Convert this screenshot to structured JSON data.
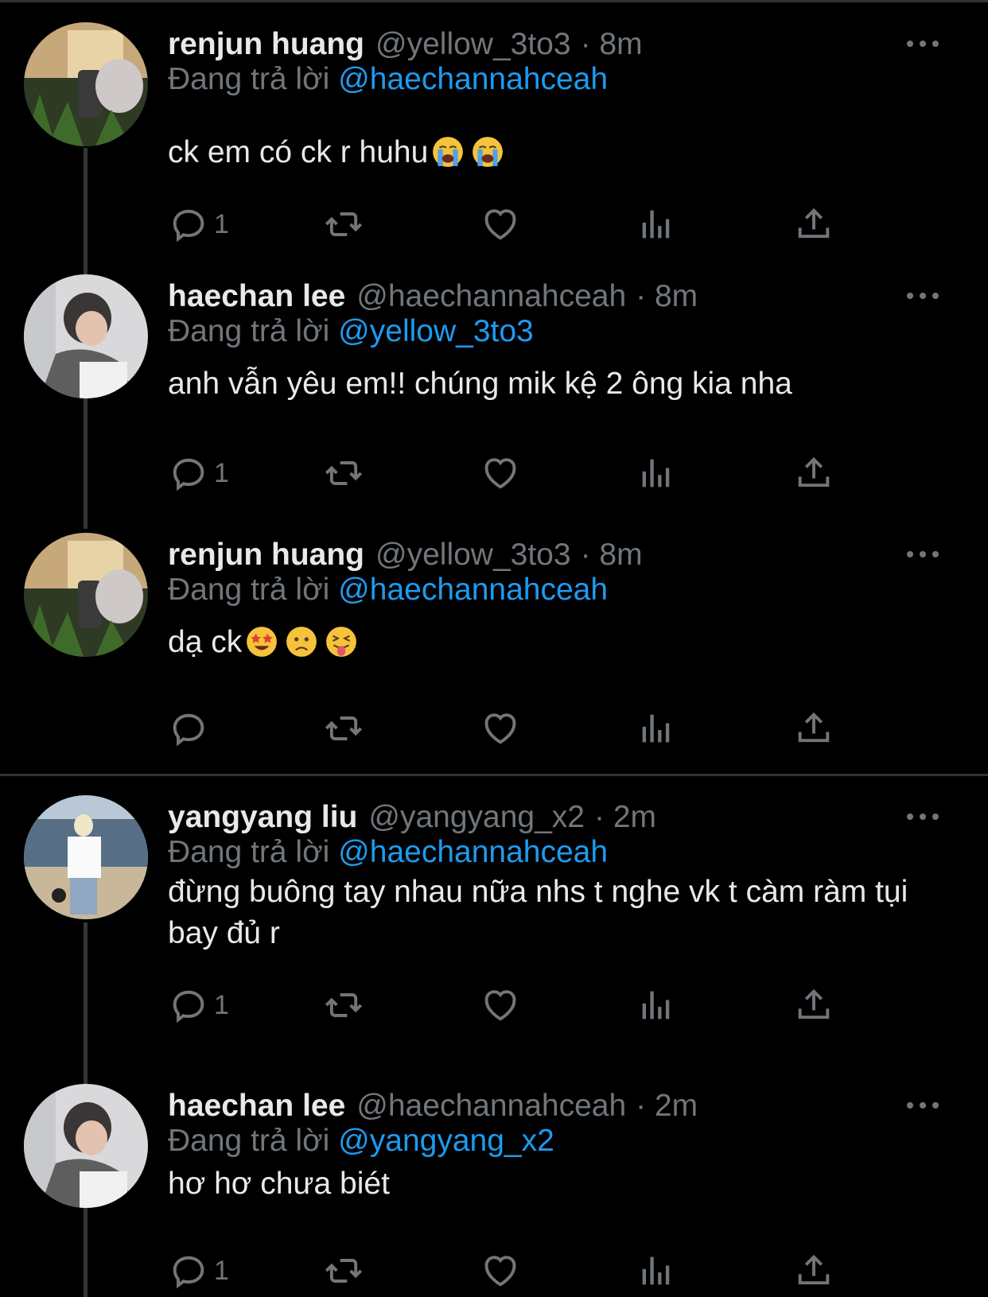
{
  "reply_prefix": "Đang trả lời",
  "tweets": [
    {
      "name": "renjun huang",
      "handle": "@yellow_3to3",
      "time": "· 8m",
      "reply_to": "@haechannahceah",
      "text": "ck em có ck r huhu",
      "emojis": [
        "loudly-crying-face-emoji",
        "loudly-crying-face-emoji"
      ],
      "replies": "1"
    },
    {
      "name": "haechan lee",
      "handle": "@haechannahceah",
      "time": "· 8m",
      "reply_to": "@yellow_3to3",
      "text": "anh vẫn yêu em!! chúng mik kệ 2 ông kia nha",
      "emojis": [],
      "replies": "1"
    },
    {
      "name": "renjun huang",
      "handle": "@yellow_3to3",
      "time": "· 8m",
      "reply_to": "@haechannahceah",
      "text": "dạ ck",
      "emojis": [
        "star-struck-emoji",
        "worried-face-emoji",
        "squinting-tongue-emoji"
      ],
      "replies": ""
    },
    {
      "name": "yangyang liu",
      "handle": "@yangyang_x2",
      "time": "· 2m",
      "reply_to": "@haechannahceah",
      "text": "đừng buông tay nhau nữa nhs t nghe vk t càm ràm tụi bay đủ r",
      "emojis": [],
      "replies": "1"
    },
    {
      "name": "haechan lee",
      "handle": "@haechannahceah",
      "time": "· 2m",
      "reply_to": "@yangyang_x2",
      "text": "hơ hơ chưa biét",
      "emojis": [],
      "replies": "1"
    }
  ],
  "colors": {
    "background": "#000000",
    "text": "#e7e9ea",
    "muted": "#71767b",
    "link": "#1d9bf0",
    "line": "#333639"
  }
}
